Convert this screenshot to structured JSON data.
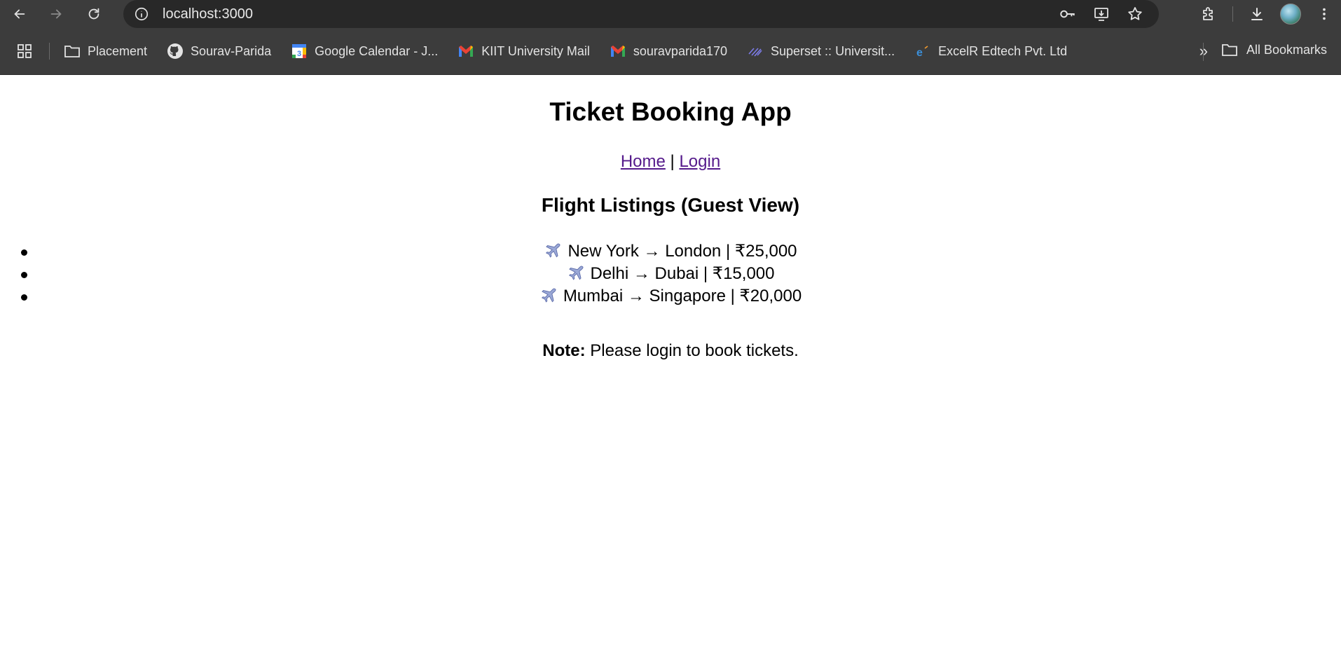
{
  "browser": {
    "url": "localhost:3000",
    "bookmarks": [
      {
        "label": "Placement",
        "icon": "folder-icon"
      },
      {
        "label": "Sourav-Parida",
        "icon": "github-icon"
      },
      {
        "label": "Google Calendar - J...",
        "icon": "google-calendar-icon"
      },
      {
        "label": "KIIT University Mail",
        "icon": "gmail-icon"
      },
      {
        "label": "souravparida170",
        "icon": "gmail-icon"
      },
      {
        "label": "Superset :: Universit...",
        "icon": "superset-icon"
      },
      {
        "label": "ExcelR Edtech Pvt. Ltd",
        "icon": "excelr-icon"
      }
    ],
    "more_bookmarks": "»",
    "all_bookmarks": "All Bookmarks"
  },
  "page": {
    "title": "Ticket Booking App",
    "nav": {
      "home": "Home",
      "separator": "|",
      "login": "Login"
    },
    "listing_title": "Flight Listings (Guest View)",
    "flights": [
      {
        "text": "New York → London | ₹25,000"
      },
      {
        "text": "Delhi → Dubai | ₹15,000"
      },
      {
        "text": "Mumbai → Singapore | ₹20,000"
      }
    ],
    "note_label": "Note:",
    "note_text": " Please login to book tickets."
  },
  "colors": {
    "chrome_bg": "#3c3c3c",
    "omnibox_bg": "#282828",
    "link_visited": "#551a8b"
  }
}
